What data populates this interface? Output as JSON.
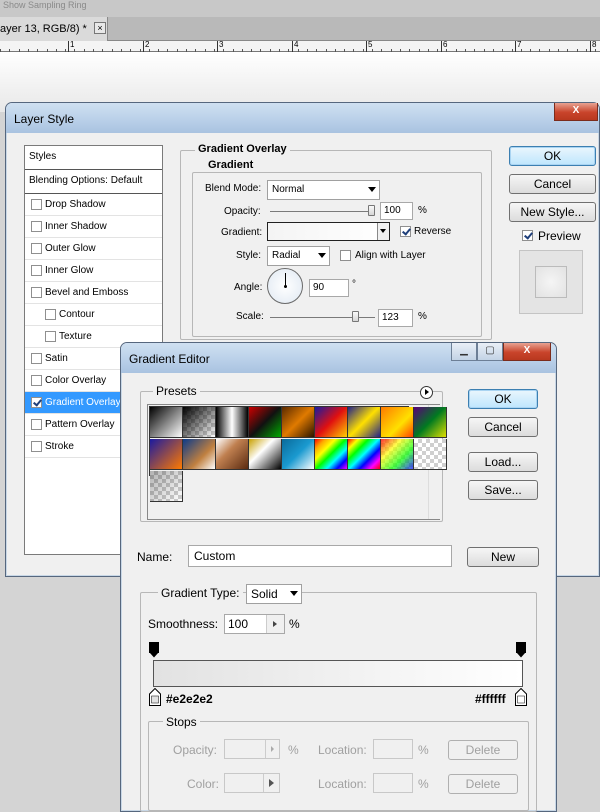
{
  "topbar": {
    "text": "Show Sampling Ring"
  },
  "document_tab": {
    "label": "ayer 13, RGB/8) *",
    "close_glyph": "×"
  },
  "ruler": {
    "numbers": [
      "1",
      "2",
      "3",
      "4",
      "5",
      "6",
      "7",
      "8"
    ]
  },
  "layer_style": {
    "title": "Layer Style",
    "close_glyph": "X",
    "styles_header": "Styles",
    "blending_options": "Blending Options: Default",
    "items": [
      {
        "label": "Drop Shadow",
        "checked": false,
        "sub": false,
        "selected": false
      },
      {
        "label": "Inner Shadow",
        "checked": false,
        "sub": false,
        "selected": false
      },
      {
        "label": "Outer Glow",
        "checked": false,
        "sub": false,
        "selected": false
      },
      {
        "label": "Inner Glow",
        "checked": false,
        "sub": false,
        "selected": false
      },
      {
        "label": "Bevel and Emboss",
        "checked": false,
        "sub": false,
        "selected": false
      },
      {
        "label": "Contour",
        "checked": false,
        "sub": true,
        "selected": false
      },
      {
        "label": "Texture",
        "checked": false,
        "sub": true,
        "selected": false
      },
      {
        "label": "Satin",
        "checked": false,
        "sub": false,
        "selected": false
      },
      {
        "label": "Color Overlay",
        "checked": false,
        "sub": false,
        "selected": false
      },
      {
        "label": "Gradient Overlay",
        "checked": true,
        "sub": false,
        "selected": true
      },
      {
        "label": "Pattern Overlay",
        "checked": false,
        "sub": false,
        "selected": false
      },
      {
        "label": "Stroke",
        "checked": false,
        "sub": false,
        "selected": false
      }
    ],
    "section_title": "Gradient Overlay",
    "group_title": "Gradient",
    "blend_mode_label": "Blend Mode:",
    "blend_mode_value": "Normal",
    "opacity_label": "Opacity:",
    "opacity_value": "100",
    "opacity_unit": "%",
    "opacity_level": 1.0,
    "gradient_label": "Gradient:",
    "reverse_label": "Reverse",
    "reverse_checked": true,
    "style_label": "Style:",
    "style_value": "Radial",
    "align_label": "Align with Layer",
    "align_checked": false,
    "angle_label": "Angle:",
    "angle_value": "90",
    "angle_unit": "°",
    "scale_label": "Scale:",
    "scale_value": "123",
    "scale_unit": "%",
    "scale_level": 0.82,
    "ok_label": "OK",
    "cancel_label": "Cancel",
    "new_style_label": "New Style...",
    "preview_label": "Preview",
    "preview_checked": true
  },
  "gradient_editor": {
    "title": "Gradient Editor",
    "minimize_glyph": "▁",
    "maximize_glyph": "▢",
    "close_glyph": "X",
    "presets_label": "Presets",
    "ok_label": "OK",
    "cancel_label": "Cancel",
    "load_label": "Load...",
    "save_label": "Save...",
    "name_label": "Name:",
    "name_value": "Custom",
    "new_label": "New",
    "gradient_type_label": "Gradient Type:",
    "gradient_type_value": "Solid",
    "smoothness_label": "Smoothness:",
    "smoothness_value": "100",
    "smoothness_unit": "%",
    "left_color": "#e2e2e2",
    "right_color": "#ffffff",
    "stops_label": "Stops",
    "opacity_label": "Opacity:",
    "opacity_unit": "%",
    "color_label": "Color:",
    "location_label": "Location:",
    "location_unit": "%",
    "delete_label": "Delete"
  },
  "colors": {
    "accent": "#3399ff",
    "gradient_start": "#e2e2e2",
    "gradient_end": "#ffffff"
  }
}
